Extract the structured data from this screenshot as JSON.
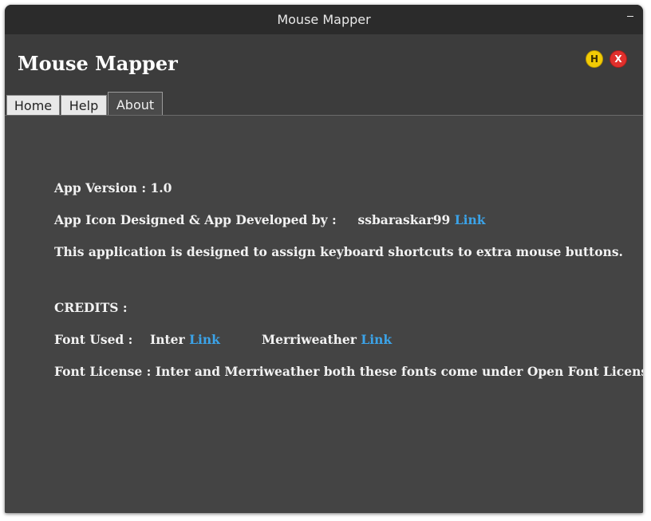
{
  "window": {
    "title": "Mouse Mapper"
  },
  "header": {
    "title": "Mouse Mapper",
    "help_button": "H",
    "close_button": "X"
  },
  "tabs": [
    {
      "label": "Home",
      "active": false
    },
    {
      "label": "Help",
      "active": false
    },
    {
      "label": "About",
      "active": true
    }
  ],
  "about": {
    "version": "App Version : 1.0",
    "developer_label": "App Icon Designed & App Developed by :",
    "developer_name": "ssbaraskar99",
    "developer_link": "Link",
    "description": "This application is designed to assign keyboard shortcuts to extra mouse buttons.",
    "credits_heading": "CREDITS :",
    "font_used_label": "Font Used :",
    "font1_name": "Inter",
    "font1_link": "Link",
    "font2_name": "Merriweather",
    "font2_link": "Link",
    "license": "Font License : Inter and Merriweather both these fonts come under Open Font License."
  },
  "colors": {
    "titlebar": "#2b2b2b",
    "header": "#3c3c3c",
    "content": "#444444",
    "link": "#3ba3e8",
    "help_button": "#f2cb05",
    "close_button": "#e0302c"
  }
}
